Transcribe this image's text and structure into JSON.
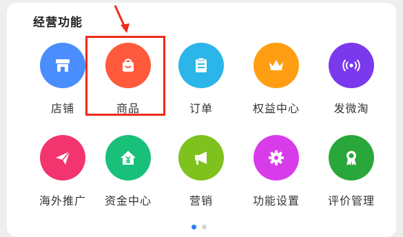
{
  "section": {
    "title": "经营功能"
  },
  "features": [
    {
      "label": "店铺",
      "icon": "store-icon",
      "color": "#4a8dfc"
    },
    {
      "label": "商品",
      "icon": "shopping-bag-icon",
      "color": "#ff5a3b"
    },
    {
      "label": "订单",
      "icon": "clipboard-icon",
      "color": "#2cb5e8"
    },
    {
      "label": "权益中心",
      "icon": "crown-icon",
      "color": "#ff9e13"
    },
    {
      "label": "发微淘",
      "icon": "broadcast-icon",
      "color": "#7b39ee"
    },
    {
      "label": "海外推广",
      "icon": "paper-plane-icon",
      "color": "#f2356f"
    },
    {
      "label": "资金中心",
      "icon": "yuan-house-icon",
      "color": "#19c079"
    },
    {
      "label": "营销",
      "icon": "megaphone-icon",
      "color": "#7fc11d"
    },
    {
      "label": "功能设置",
      "icon": "gear-icon",
      "color": "#d83bea"
    },
    {
      "label": "评价管理",
      "icon": "award-badge-icon",
      "color": "#29a73a"
    }
  ],
  "annotation": {
    "highlight_color": "#ef2a1a",
    "highlighted_item": "商品"
  },
  "pager": {
    "count": 2,
    "active_index": 0,
    "active_color": "#2d7cf6"
  }
}
